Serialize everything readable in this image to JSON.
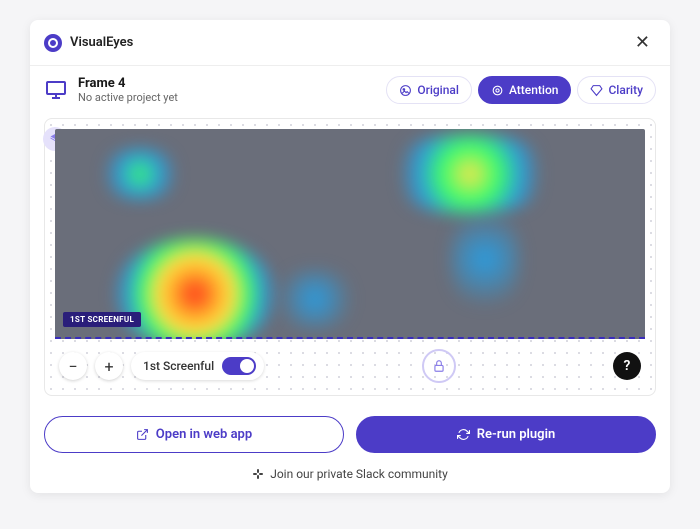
{
  "app": {
    "name": "VisualEyes"
  },
  "frame": {
    "title": "Frame 4",
    "subtitle": "No active project yet"
  },
  "tabs": {
    "original": "Original",
    "attention": "Attention",
    "clarity": "Clarity"
  },
  "screenful_tag": "1ST SCREENFUL",
  "controls": {
    "screenful_label": "1st Screenful",
    "screenful_on": true
  },
  "buttons": {
    "open": "Open in web app",
    "rerun": "Re-run plugin"
  },
  "footer": {
    "slack": "Join our private Slack community"
  },
  "help": "?"
}
